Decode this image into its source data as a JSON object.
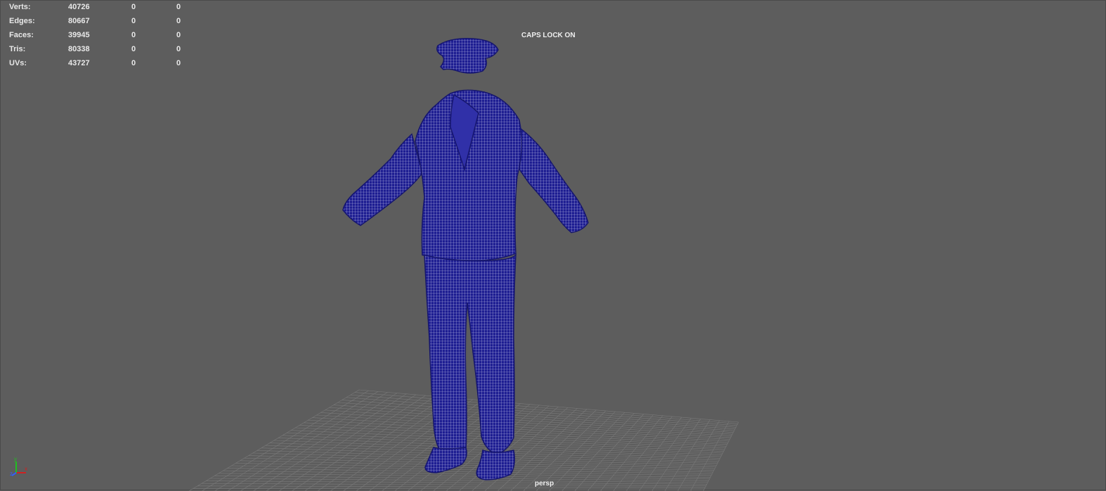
{
  "hud": {
    "rows": [
      {
        "label": "Verts:",
        "values": [
          "40726",
          "0",
          "0"
        ]
      },
      {
        "label": "Edges:",
        "values": [
          "80667",
          "0",
          "0"
        ]
      },
      {
        "label": "Faces:",
        "values": [
          "39945",
          "0",
          "0"
        ]
      },
      {
        "label": "Tris:",
        "values": [
          "80338",
          "0",
          "0"
        ]
      },
      {
        "label": "UVs:",
        "values": [
          "43727",
          "0",
          "0"
        ]
      }
    ]
  },
  "status": {
    "caps_lock": "CAPS LOCK ON"
  },
  "camera": {
    "name": "persp"
  },
  "axis": {
    "x": "x",
    "y": "y",
    "z": "z"
  },
  "colors": {
    "background": "#5d5d5d",
    "grid": "#7a7a7a",
    "wireframe": "#1a1a8c",
    "wireframe_fill": "#22229a",
    "axis_x": "#d02020",
    "axis_y": "#20c020",
    "axis_z": "#3060ff"
  }
}
